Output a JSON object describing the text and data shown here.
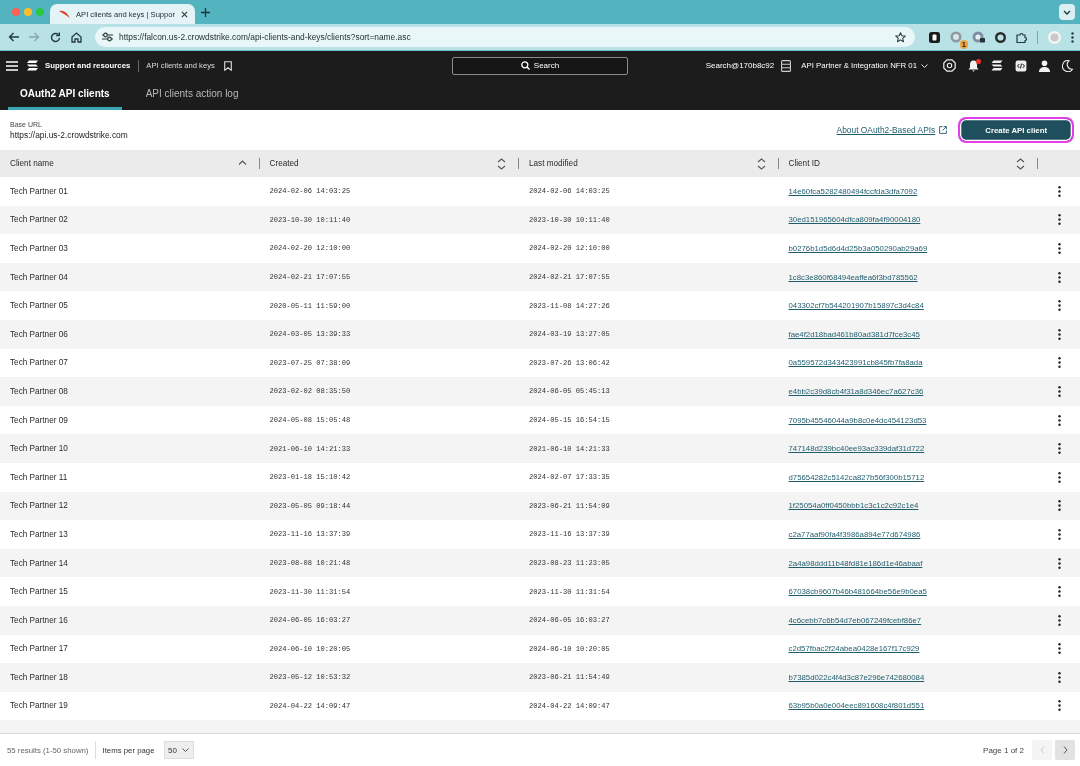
{
  "browser": {
    "tab": {
      "title": "API clients and keys | Suppor"
    },
    "address": "https://falcon.us-2.crowdstrike.com/api-clients-and-keys/clients?sort=name.asc",
    "forward_disabled": true,
    "extension_badge": "1"
  },
  "app_bar": {
    "section": "Support and resources",
    "page": "API clients and keys",
    "search": {
      "label": "Search"
    },
    "account": "Search@170b8c92",
    "tenant": "API Partner & Integration NFR 01",
    "notifications_unread": true
  },
  "tabs": [
    {
      "label": "OAuth2 API clients",
      "selected": true
    },
    {
      "label": "API clients action log",
      "selected": false
    }
  ],
  "base_url": {
    "label": "Base URL",
    "value": "https://api.us-2.crowdstrike.com"
  },
  "about_link": "About OAuth2-Based APIs",
  "create_button": {
    "label": "Create API client",
    "highlighted": true
  },
  "table": {
    "columns": [
      {
        "label": "Client name",
        "sorted": true
      },
      {
        "label": "Created",
        "sorted": false
      },
      {
        "label": "Last modified",
        "sorted": false
      },
      {
        "label": "Client ID",
        "sorted": false
      }
    ],
    "rows": [
      {
        "name": "Tech Partner 01",
        "created": "2024-02-06 14:03:25",
        "modified": "2024-02-06 14:03:25",
        "client_id": "14e60fca5282480494fccfda3dfa7092"
      },
      {
        "name": "Tech Partner 02",
        "created": "2023-10-30 10:11:40",
        "modified": "2023-10-30 10:11:40",
        "client_id": "30ed151965604dfca809fa4f90004180"
      },
      {
        "name": "Tech Partner 03",
        "created": "2024-02-20 12:10:00",
        "modified": "2024-02-20 12:10:00",
        "client_id": "b0276b1d5d6d4d25b3a050290ab29a69"
      },
      {
        "name": "Tech Partner 04",
        "created": "2024-02-21 17:07:55",
        "modified": "2024-02-21 17:07:55",
        "client_id": "1c8c3e860f68494eaffea6f3bd785562"
      },
      {
        "name": "Tech Partner 05",
        "created": "2020-05-11 11:59:00",
        "modified": "2023-11-08 14:27:26",
        "client_id": "043302cf7b544201907b15897c3d4c84"
      },
      {
        "name": "Tech Partner 06",
        "created": "2024-03-05 13:39:33",
        "modified": "2024-03-19 13:27:05",
        "client_id": "fae4f2d18bad461b80ad381d7fce3c45"
      },
      {
        "name": "Tech Partner 07",
        "created": "2023-07-25 07:38:09",
        "modified": "2023-07-26 13:06:42",
        "client_id": "0a559572d343423991cb845fb7fa8ada"
      },
      {
        "name": "Tech Partner 08",
        "created": "2023-02-02 08:35:50",
        "modified": "2024-06-05 05:45:13",
        "client_id": "e4bb2c39d8cb4f31a8d346ec7a627c36"
      },
      {
        "name": "Tech Partner 09",
        "created": "2024-05-08 15:05:48",
        "modified": "2024-05-15 16:54:15",
        "client_id": "7095b45546044a9b8c0e4dc454123d53"
      },
      {
        "name": "Tech Partner 10",
        "created": "2021-06-10 14:21:33",
        "modified": "2021-06-10 14:21:33",
        "client_id": "747148d239bc40ee93ac339daf31d722"
      },
      {
        "name": "Tech Partner 11",
        "created": "2023-01-18 15:10:42",
        "modified": "2024-02-07 17:33:35",
        "client_id": "d75654282c5142ca827b56f300b15712"
      },
      {
        "name": "Tech Partner 12",
        "created": "2023-05-05 09:18:44",
        "modified": "2023-06-21 11:54:09",
        "client_id": "1f25054a0ff0450bbb1c3c1c2c92c1e4"
      },
      {
        "name": "Tech Partner 13",
        "created": "2023-11-16 13:37:39",
        "modified": "2023-11-16 13:37:39",
        "client_id": "c2a77aaf90fa4f3986a894e77d674986"
      },
      {
        "name": "Tech Partner 14",
        "created": "2023-08-08 10:21:48",
        "modified": "2023-08-23 11:23:05",
        "client_id": "2a4a98ddd11b48fd81e186d1e46abaaf"
      },
      {
        "name": "Tech Partner 15",
        "created": "2023-11-30 11:31:54",
        "modified": "2023-11-30 11:31:54",
        "client_id": "67038cb9607b46b481664be56e9b0ea5"
      },
      {
        "name": "Tech Partner 16",
        "created": "2024-06-05 16:03:27",
        "modified": "2024-06-05 16:03:27",
        "client_id": "4c6cebb7c6b54d7eb067249fcebf86e7"
      },
      {
        "name": "Tech Partner 17",
        "created": "2024-06-10 10:20:05",
        "modified": "2024-06-10 10:20:05",
        "client_id": "c2d57fbac2f24abea0428e167f17c929"
      },
      {
        "name": "Tech Partner 18",
        "created": "2023-05-12 10:53:32",
        "modified": "2023-06-21 11:54:49",
        "client_id": "b7385d022c4f4d3c87e296e742680084"
      },
      {
        "name": "Tech Partner 19",
        "created": "2024-04-22 14:09:47",
        "modified": "2024-04-22 14:09:47",
        "client_id": "63b95b0a0e004eec891608c4f801d551"
      }
    ]
  },
  "footer": {
    "results": "55 results (1-50 shown)",
    "per_page_label": "Items per page",
    "per_page": "50",
    "page": "Page 1 of 2",
    "prev_disabled": true,
    "next_disabled": false
  }
}
